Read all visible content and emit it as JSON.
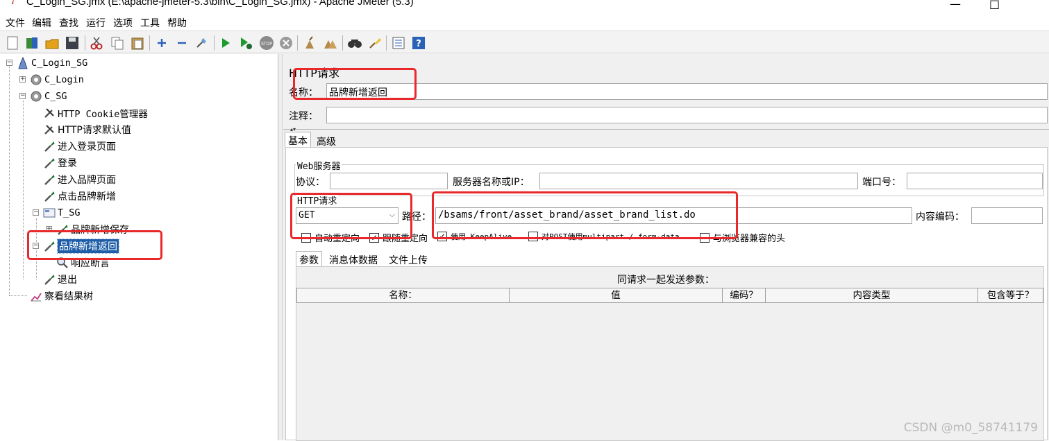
{
  "window": {
    "title": "C_Login_SG.jmx (E:\\apache-jmeter-5.3\\bin\\C_Login_SG.jmx) - Apache JMeter (5.3)",
    "minimize": "—",
    "maximize": "□"
  },
  "menu": [
    "文件",
    "编辑",
    "查找",
    "运行",
    "选项",
    "工具",
    "帮助"
  ],
  "toolbar_icons": [
    "new-icon",
    "templates-icon",
    "open-icon",
    "save-icon",
    "cut-icon",
    "copy-icon",
    "paste-icon",
    "expand-icon",
    "collapse-icon",
    "toggle-icon",
    "start-icon",
    "start-no-pause-icon",
    "stop-icon",
    "shutdown-icon",
    "clear-icon",
    "clear-all-icon",
    "search-icon",
    "reset-search-icon",
    "function-helper-icon",
    "help-icon"
  ],
  "tree": {
    "root": "C_Login_SG",
    "login": "C_Login",
    "sg": "C_SG",
    "cookie_manager": "HTTP Cookie管理器",
    "defaults": "HTTP请求默认值",
    "enter_login": "进入登录页面",
    "login_step": "登录",
    "enter_brand": "进入品牌页面",
    "click_add": "点击品牌新增",
    "t_sg": "T_SG",
    "brand_save": "品牌新增保存",
    "brand_return": "品牌新增返回",
    "response_assert": "响应断言",
    "logout": "退出",
    "result_tree": "察看结果树"
  },
  "form": {
    "panel_title": "HTTP请求",
    "name_label": "名称：",
    "name_value": "品牌新增返回",
    "comment_label": "注释：",
    "comment_value": "",
    "tabs": [
      "基本",
      "高级"
    ],
    "web_server_title": "Web服务器",
    "protocol_label": "协议：",
    "protocol_value": "",
    "server_label": "服务器名称或IP：",
    "server_value": "",
    "port_label": "端口号：",
    "port_value": "",
    "http_request_title": "HTTP请求",
    "method": "GET",
    "path_label": "路径：",
    "path_value": "/bsams/front/asset_brand/asset_brand_list.do",
    "encoding_label": "内容编码：",
    "encoding_value": "",
    "checks": {
      "auto_redirect": {
        "label": "自动重定向",
        "checked": false
      },
      "follow_redirect": {
        "label": "跟随重定向",
        "checked": true
      },
      "keepalive": {
        "label": "使用 KeepAlive",
        "checked": true
      },
      "multipart": {
        "label": "对POST使用multipart / form-data",
        "checked": false
      },
      "browser_headers": {
        "label": "与浏览器兼容的头",
        "checked": false
      }
    },
    "param_tabs": [
      "参数",
      "消息体数据",
      "文件上传"
    ],
    "params_caption": "同请求一起发送参数：",
    "columns": [
      "名称：",
      "值",
      "编码？",
      "内容类型",
      "包含等于？"
    ]
  },
  "watermark": "CSDN @m0_58741179",
  "colors": {
    "highlight": "#e8282a",
    "selection": "#1e5ea8"
  }
}
